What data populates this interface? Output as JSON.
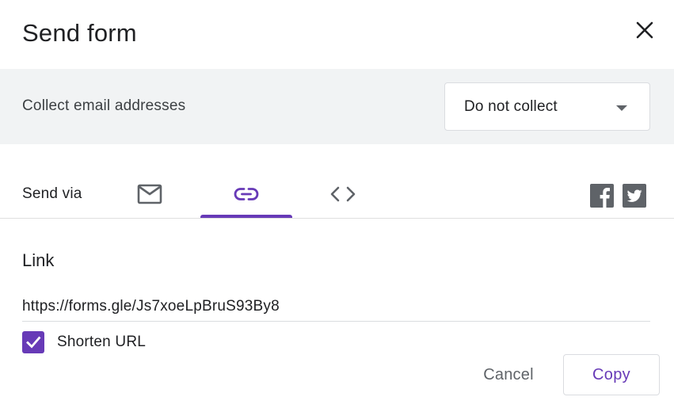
{
  "dialog": {
    "title": "Send form",
    "close_icon": "close-icon"
  },
  "collect": {
    "label": "Collect email addresses",
    "selected": "Do not collect",
    "arrow_icon": "dropdown-arrow-icon"
  },
  "send_via": {
    "label": "Send via",
    "tabs": [
      {
        "icon": "email-icon",
        "selected": false
      },
      {
        "icon": "link-icon",
        "selected": true
      },
      {
        "icon": "embed-code-icon",
        "selected": false
      }
    ],
    "social": [
      {
        "icon": "facebook-icon"
      },
      {
        "icon": "twitter-icon"
      }
    ]
  },
  "link_section": {
    "title": "Link",
    "url": "https://forms.gle/Js7xoeLpBruS93By8",
    "shorten_label": "Shorten URL",
    "shorten_checked": true
  },
  "actions": {
    "cancel_label": "Cancel",
    "copy_label": "Copy"
  },
  "colors": {
    "accent": "#673ab7",
    "band_bg": "#f1f3f4",
    "icon_gray": "#5f6368"
  }
}
